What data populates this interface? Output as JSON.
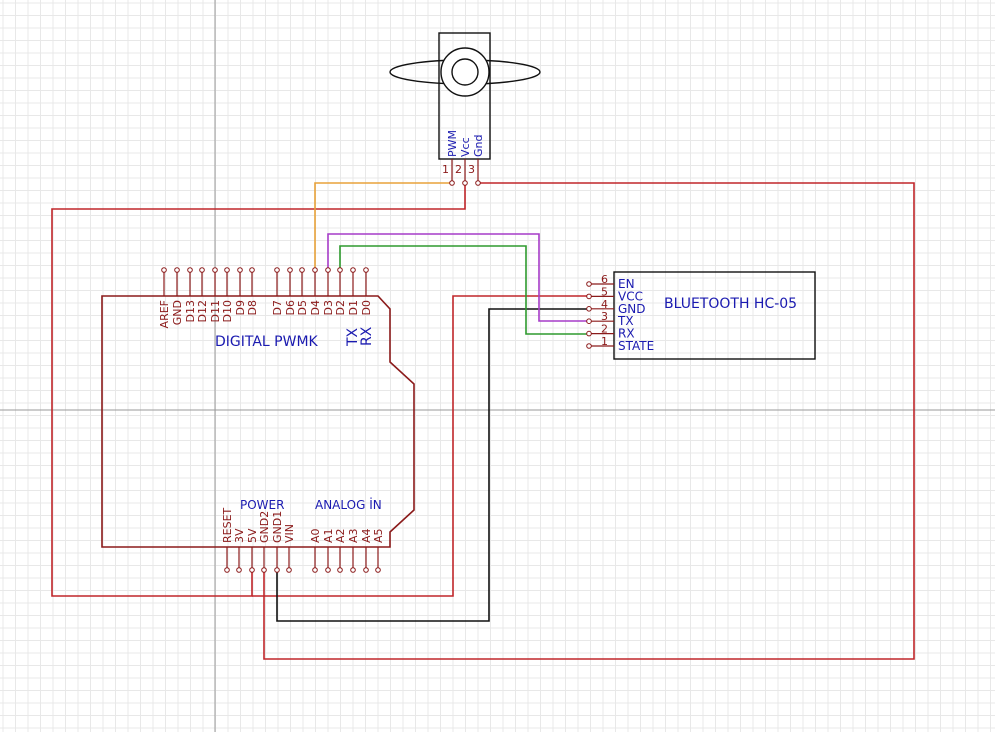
{
  "servo": {
    "pins": [
      "PWM",
      "Vcc",
      "Gnd"
    ],
    "pin_numbers": [
      "1",
      "2",
      "3"
    ]
  },
  "arduino": {
    "digital_label": "DIGITAL PWMK",
    "tx_label": "TX",
    "rx_label": "RX",
    "power_label": "POWER",
    "analog_label": "ANALOG İN",
    "digital_pins": [
      "AREF",
      "GND",
      "D13",
      "D12",
      "D11",
      "D10",
      "D9",
      "D8",
      "D7",
      "D6",
      "D5",
      "D4",
      "D3",
      "D2",
      "D1",
      "D0"
    ],
    "power_pins": [
      "RESET",
      "3V",
      "5V",
      "GND2",
      "GND1",
      "VIN"
    ],
    "analog_pins": [
      "A0",
      "A1",
      "A2",
      "A3",
      "A4",
      "A5"
    ]
  },
  "bluetooth": {
    "title": "BLUETOOTH HC-05",
    "pins": [
      {
        "num": "6",
        "name": "EN"
      },
      {
        "num": "5",
        "name": "VCC"
      },
      {
        "num": "4",
        "name": "GND"
      },
      {
        "num": "3",
        "name": "TX"
      },
      {
        "num": "2",
        "name": "RX"
      },
      {
        "num": "1",
        "name": "STATE"
      }
    ]
  },
  "colors": {
    "power_wire": "#c0262a",
    "ground_wire": "#111111",
    "signal_wire": "#e8a23a",
    "tx_wire": "#a63cc8",
    "rx_wire": "#2e9a2e",
    "component": "#8b1a1a",
    "label_blue": "#1a1ab0"
  },
  "icons": {
    "servo_horn": "servo-horn-icon"
  }
}
